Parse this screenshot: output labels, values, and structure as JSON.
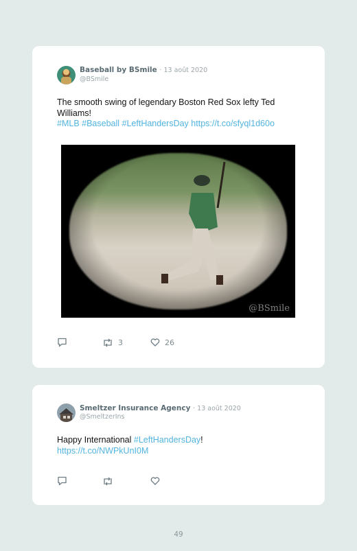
{
  "tweets": [
    {
      "author": "Baseball by BSmile",
      "date": "· 13 août 2020",
      "handle": "@BSmile",
      "text_line1": "The smooth swing of legendary Boston Red Sox lefty Ted",
      "text_line2": "Williams!",
      "hashtags": [
        "#MLB",
        "#Baseball",
        "#LeftHandersDay"
      ],
      "link": "https://t.co/sfyql1d60o",
      "media_watermark": "@BSmile",
      "retweets": "3",
      "likes": "26"
    },
    {
      "author": "Smeltzer Insurance Agency",
      "date": "· 13 août 2020",
      "handle": "@SmeltzerIns",
      "text_prefix": "Happy International ",
      "hashtag": "#LeftHandersDay",
      "text_suffix": "!",
      "link": "https://t.co/NWPkUnI0M",
      "retweets": "",
      "likes": ""
    }
  ],
  "page_number": "49",
  "colors": {
    "background": "#e2ebea",
    "link": "#52b4e0",
    "card": "#ffffff"
  },
  "icons": [
    "reply-icon",
    "retweet-icon",
    "like-icon"
  ]
}
